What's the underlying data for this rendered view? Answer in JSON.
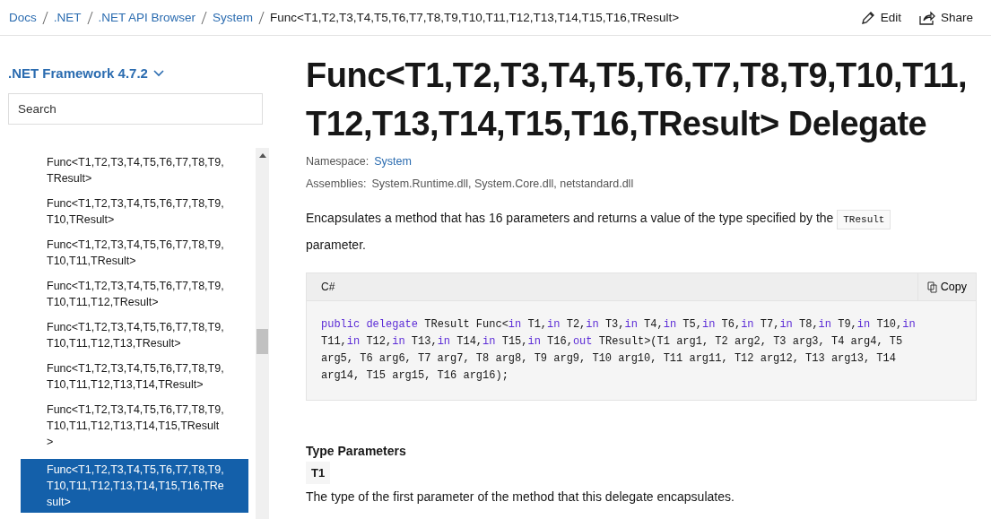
{
  "breadcrumbs": [
    {
      "label": "Docs",
      "link": true
    },
    {
      "label": ".NET",
      "link": true
    },
    {
      "label": ".NET API Browser",
      "link": true
    },
    {
      "label": "System",
      "link": true
    },
    {
      "label": "Func<T1,T2,T3,T4,T5,T6,T7,T8,T9,T10,T11,T12,T13,T14,T15,T16,TResult>",
      "link": false
    }
  ],
  "actions": [
    {
      "label": "Edit",
      "kind": "edit"
    },
    {
      "label": "Share",
      "kind": "share"
    }
  ],
  "sidebar": {
    "version": ".NET Framework 4.7.2",
    "search": {
      "placeholder": "Search"
    },
    "items": [
      {
        "lines": [
          "Func<T1,T2,T3,T4,T5,T6,T7,T8,T9,",
          "TResult>"
        ],
        "selected": false
      },
      {
        "lines": [
          "Func<T1,T2,T3,T4,T5,T6,T7,T8,T9,",
          "T10,TResult>"
        ],
        "selected": false
      },
      {
        "lines": [
          "Func<T1,T2,T3,T4,T5,T6,T7,T8,T9,",
          "T10,T11,TResult>"
        ],
        "selected": false
      },
      {
        "lines": [
          "Func<T1,T2,T3,T4,T5,T6,T7,T8,T9,",
          "T10,T11,T12,TResult>"
        ],
        "selected": false
      },
      {
        "lines": [
          "Func<T1,T2,T3,T4,T5,T6,T7,T8,T9,",
          "T10,T11,T12,T13,TResult>"
        ],
        "selected": false
      },
      {
        "lines": [
          "Func<T1,T2,T3,T4,T5,T6,T7,T8,T9,",
          "T10,T11,T12,T13,T14,TResult>"
        ],
        "selected": false
      },
      {
        "lines": [
          "Func<T1,T2,T3,T4,T5,T6,T7,T8,T9,",
          "T10,T11,T12,T13,T14,T15,TResult",
          ">"
        ],
        "selected": false
      },
      {
        "lines": [
          "Func<T1,T2,T3,T4,T5,T6,T7,T8,T9,",
          "T10,T11,T12,T13,T14,T15,T16,TRe",
          "sult>"
        ],
        "selected": true
      }
    ]
  },
  "title_lines": [
    "Func<T1,T2,T3,T4,T5,T6,T7,T8,T9,T10,T11,",
    "T12,T13,T14,T15,T16,TResult> Delegate"
  ],
  "namespace": {
    "label": "Namespace:",
    "value": "System"
  },
  "assemblies": {
    "label": "Assemblies:",
    "value": "System.Runtime.dll, System.Core.dll, netstandard.dll"
  },
  "summary": {
    "before": "Encapsulates a method that has 16 parameters and returns a value of the type specified by the",
    "code": "TResult",
    "after": "parameter."
  },
  "code_block": {
    "language": "C#",
    "copy_label": "Copy",
    "lines": [
      [
        {
          "text": "public delegate",
          "kind": "keyword"
        },
        {
          "text": " TResult Func<",
          "kind": "plain"
        },
        {
          "text": "in",
          "kind": "keyword"
        },
        {
          "text": " T1,",
          "kind": "plain"
        },
        {
          "text": "in",
          "kind": "keyword"
        },
        {
          "text": " T2,",
          "kind": "plain"
        },
        {
          "text": "in",
          "kind": "keyword"
        },
        {
          "text": " T3,",
          "kind": "plain"
        },
        {
          "text": "in",
          "kind": "keyword"
        },
        {
          "text": " T4,",
          "kind": "plain"
        },
        {
          "text": "in",
          "kind": "keyword"
        },
        {
          "text": " T5,",
          "kind": "plain"
        },
        {
          "text": "in",
          "kind": "keyword"
        },
        {
          "text": " T6,",
          "kind": "plain"
        },
        {
          "text": "in",
          "kind": "keyword"
        },
        {
          "text": " T7,",
          "kind": "plain"
        },
        {
          "text": "in",
          "kind": "keyword"
        },
        {
          "text": " T8,",
          "kind": "plain"
        },
        {
          "text": "in",
          "kind": "keyword"
        },
        {
          "text": " T9,",
          "kind": "plain"
        },
        {
          "text": "in",
          "kind": "keyword"
        },
        {
          "text": " T10,",
          "kind": "plain"
        },
        {
          "text": "in",
          "kind": "keyword"
        }
      ],
      [
        {
          "text": "T11,",
          "kind": "plain"
        },
        {
          "text": "in",
          "kind": "keyword"
        },
        {
          "text": " T12,",
          "kind": "plain"
        },
        {
          "text": "in",
          "kind": "keyword"
        },
        {
          "text": " T13,",
          "kind": "plain"
        },
        {
          "text": "in",
          "kind": "keyword"
        },
        {
          "text": " T14,",
          "kind": "plain"
        },
        {
          "text": "in",
          "kind": "keyword"
        },
        {
          "text": " T15,",
          "kind": "plain"
        },
        {
          "text": "in",
          "kind": "keyword"
        },
        {
          "text": " T16,",
          "kind": "plain"
        },
        {
          "text": "out",
          "kind": "keyword"
        },
        {
          "text": " TResult>(T1 arg1, T2 arg2, T3 arg3, T4 arg4, T5",
          "kind": "plain"
        }
      ],
      [
        {
          "text": "arg5, T6 arg6, T7 arg7, T8 arg8, T9 arg9, T10 arg10, T11 arg11, T12 arg12, T13 arg13, T14",
          "kind": "plain"
        }
      ],
      [
        {
          "text": "arg14, T15 arg15, T16 arg16);",
          "kind": "plain"
        }
      ]
    ]
  },
  "type_parameters": {
    "heading": "Type Parameters",
    "items": [
      {
        "name": "T1",
        "description": "The type of the first parameter of the method that this delegate encapsulates."
      }
    ]
  }
}
